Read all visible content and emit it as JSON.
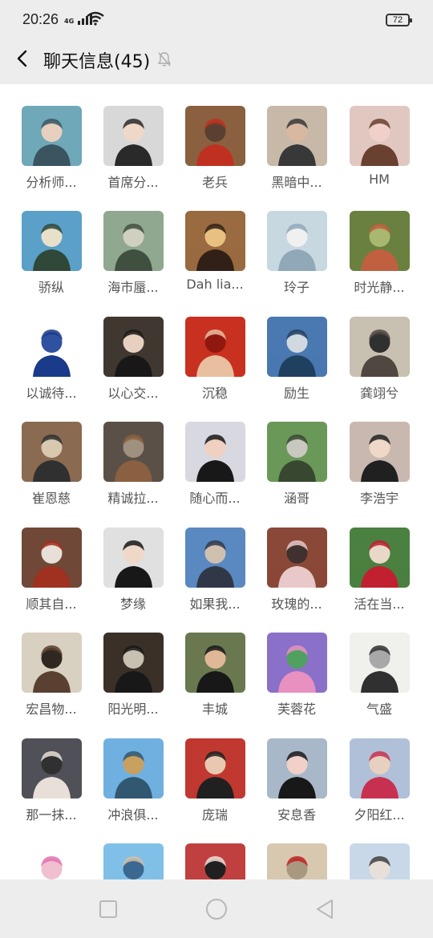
{
  "status_bar": {
    "time": "20:26",
    "network": "4G",
    "battery": "72"
  },
  "nav": {
    "title": "聊天信息(45)"
  },
  "members": [
    {
      "name": "分析师...",
      "colors": [
        "#6fa8b8",
        "#3a5560",
        "#e8d0c0"
      ]
    },
    {
      "name": "首席分...",
      "colors": [
        "#d8d8d8",
        "#2a2a2a",
        "#f0d8c8"
      ]
    },
    {
      "name": "老兵",
      "colors": [
        "#8a6040",
        "#c03020",
        "#5a4030"
      ]
    },
    {
      "name": "黑暗中...",
      "colors": [
        "#c8b8a8",
        "#383838",
        "#d8b8a0"
      ]
    },
    {
      "name": "HM",
      "colors": [
        "#e0c8c0",
        "#6a4030",
        "#f0d0c8"
      ]
    },
    {
      "name": "骄纵",
      "colors": [
        "#5aa0c8",
        "#304838",
        "#e8e0c8"
      ]
    },
    {
      "name": "海市蜃...",
      "colors": [
        "#90a890",
        "#405040",
        "#d0d0c0"
      ]
    },
    {
      "name": "Dah lia...",
      "colors": [
        "#9a6a40",
        "#302018",
        "#e8c080"
      ]
    },
    {
      "name": "玲子",
      "colors": [
        "#c8d8e0",
        "#90a8b8",
        "#f0f0f0"
      ]
    },
    {
      "name": "时光静...",
      "colors": [
        "#6a8040",
        "#c06040",
        "#a8b870"
      ]
    },
    {
      "name": "以诚待...",
      "colors": [
        "#ffffff",
        "#1a3a8a",
        "#3050a0"
      ]
    },
    {
      "name": "以心交...",
      "colors": [
        "#403830",
        "#181818",
        "#e8d0c0"
      ]
    },
    {
      "name": "沉稳",
      "colors": [
        "#c83020",
        "#e8c0a0",
        "#901810"
      ]
    },
    {
      "name": "励生",
      "colors": [
        "#4a78b0",
        "#204060",
        "#d0d8e0"
      ]
    },
    {
      "name": "龚翊兮",
      "colors": [
        "#c8c0b0",
        "#504840",
        "#303030"
      ]
    },
    {
      "name": "崔恩慈",
      "colors": [
        "#8a6a50",
        "#303030",
        "#d8c8b0"
      ]
    },
    {
      "name": "精诚拉...",
      "colors": [
        "#5a5048",
        "#8a6040",
        "#a09080"
      ]
    },
    {
      "name": "随心而...",
      "colors": [
        "#d8d8e0",
        "#181818",
        "#f0d0c0"
      ]
    },
    {
      "name": "涵哥",
      "colors": [
        "#6a9858",
        "#384830",
        "#c8c8c0"
      ]
    },
    {
      "name": "李浩宇",
      "colors": [
        "#c8b8b0",
        "#202020",
        "#f0d8c8"
      ]
    },
    {
      "name": "顺其自...",
      "colors": [
        "#704838",
        "#a03020",
        "#e8e0d8"
      ]
    },
    {
      "name": "梦缘",
      "colors": [
        "#e0e0e0",
        "#181818",
        "#f0d8c8"
      ]
    },
    {
      "name": "如果我...",
      "colors": [
        "#5a88c0",
        "#303848",
        "#d0c0b0"
      ]
    },
    {
      "name": "玫瑰的...",
      "colors": [
        "#8a4838",
        "#e8c8c8",
        "#403030"
      ]
    },
    {
      "name": "活在当...",
      "colors": [
        "#4a8040",
        "#c02030",
        "#e8d8c8"
      ]
    },
    {
      "name": "宏昌物...",
      "colors": [
        "#d8d0c0",
        "#5a4030",
        "#302820"
      ]
    },
    {
      "name": "阳光明...",
      "colors": [
        "#3a3028",
        "#181818",
        "#c8c0b0"
      ]
    },
    {
      "name": "丰城",
      "colors": [
        "#6a7850",
        "#181818",
        "#e0b898"
      ]
    },
    {
      "name": "芙蓉花",
      "colors": [
        "#8a70c8",
        "#e890c0",
        "#50a060"
      ]
    },
    {
      "name": "气盛",
      "colors": [
        "#f0f0ec",
        "#303030",
        "#a8a8a8"
      ]
    },
    {
      "name": "那一抹...",
      "colors": [
        "#505058",
        "#e8e0d8",
        "#303030"
      ]
    },
    {
      "name": "冲浪俱...",
      "colors": [
        "#70b0e0",
        "#305870",
        "#c8a060"
      ]
    },
    {
      "name": "庞瑞",
      "colors": [
        "#c03830",
        "#202020",
        "#e8c8b0"
      ]
    },
    {
      "name": "安息香",
      "colors": [
        "#a8b8c8",
        "#181818",
        "#f0d0c8"
      ]
    },
    {
      "name": "夕阳红...",
      "colors": [
        "#b0c0d8",
        "#c83050",
        "#e8d0c0"
      ]
    },
    {
      "name": "",
      "colors": [
        "#ffffff",
        "#e070b0",
        "#f0c0d0"
      ]
    },
    {
      "name": "",
      "colors": [
        "#80c0e8",
        "#d0c0a8",
        "#3a6890"
      ]
    },
    {
      "name": "",
      "colors": [
        "#c04040",
        "#f0e0d8",
        "#202020"
      ]
    },
    {
      "name": "",
      "colors": [
        "#d8c8b0",
        "#c02020",
        "#a89880"
      ]
    },
    {
      "name": "",
      "colors": [
        "#c8d8e8",
        "#404040",
        "#e8e0d8"
      ]
    }
  ],
  "icons": {
    "back": "chevron-left-icon",
    "mute": "bell-off-icon",
    "home": "circle-icon",
    "recent": "square-icon",
    "nav_back": "triangle-left-icon"
  }
}
